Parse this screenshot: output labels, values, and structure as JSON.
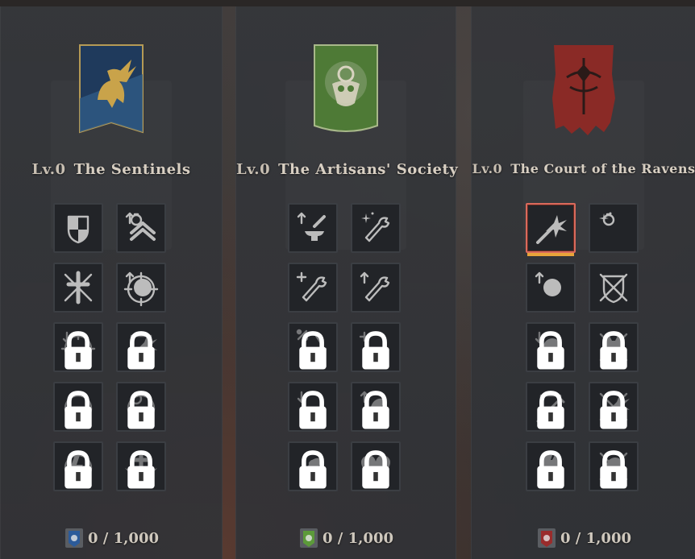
{
  "factions": [
    {
      "id": "sentinels",
      "level": "Lv.0",
      "name": "The Sentinels",
      "progress": "0 / 1,000",
      "progress_value": 0,
      "progress_max": 1000,
      "banner_color": "#1f3a5c",
      "banner_accent": "#c9a34a",
      "medal_color": "#2c5b9a",
      "skills": [
        {
          "icon": "shield-quarter-icon",
          "locked": false
        },
        {
          "icon": "potion-chevron-up-icon",
          "locked": false
        },
        {
          "icon": "crossed-swords-emblem-icon",
          "locked": false
        },
        {
          "icon": "target-skull-up-icon",
          "locked": false
        },
        {
          "icon": "crosshair-down-icon",
          "locked": true
        },
        {
          "icon": "shield-burst-icon",
          "locked": true
        },
        {
          "icon": "cycle-arrow-icon",
          "locked": true
        },
        {
          "icon": "potion-circle-icon",
          "locked": true
        },
        {
          "icon": "lightning-circle-icon",
          "locked": true
        },
        {
          "icon": "winged-cross-icon",
          "locked": true
        }
      ]
    },
    {
      "id": "artisans",
      "level": "Lv.0",
      "name": "The Artisans' Society",
      "progress": "0 / 1,000",
      "progress_value": 0,
      "progress_max": 1000,
      "banner_color": "#4e7a36",
      "banner_accent": "#d8d3c0",
      "medal_color": "#5c9a3a",
      "skills": [
        {
          "icon": "anvil-up-icon",
          "locked": false
        },
        {
          "icon": "wrench-sparkle-icon",
          "locked": false
        },
        {
          "icon": "wrench-plus-icon",
          "locked": false
        },
        {
          "icon": "wrench-up-icon",
          "locked": false
        },
        {
          "icon": "percent-scroll-icon",
          "locked": true
        },
        {
          "icon": "cauldron-plus-icon",
          "locked": true
        },
        {
          "icon": "cauldron-down-icon",
          "locked": true
        },
        {
          "icon": "horse-up-icon",
          "locked": true
        },
        {
          "icon": "horse-saddle-icon",
          "locked": true
        },
        {
          "icon": "heart-icon",
          "locked": true
        }
      ]
    },
    {
      "id": "ravens",
      "level": "Lv.0",
      "name": "The Court of the Ravens",
      "progress": "0 / 1,000",
      "progress_value": 0,
      "progress_max": 1000,
      "banner_color": "#8a2a26",
      "banner_accent": "#2a1a18",
      "medal_color": "#9a2c2c",
      "skills": [
        {
          "icon": "sword-burst-icon",
          "locked": false,
          "selected": true
        },
        {
          "icon": "potion-sparkle-icon",
          "locked": false
        },
        {
          "icon": "skull-up-icon",
          "locked": false
        },
        {
          "icon": "shield-crossed-swords-icon",
          "locked": false
        },
        {
          "icon": "skull-down-icon",
          "locked": true
        },
        {
          "icon": "crossed-bones-beast-icon",
          "locked": true
        },
        {
          "icon": "shield-sword-icon",
          "locked": true
        },
        {
          "icon": "crossed-swords-burst-icon",
          "locked": true
        },
        {
          "icon": "beast-lightning-icon",
          "locked": true
        },
        {
          "icon": "crossed-swords-skull-icon",
          "locked": true
        }
      ]
    }
  ]
}
